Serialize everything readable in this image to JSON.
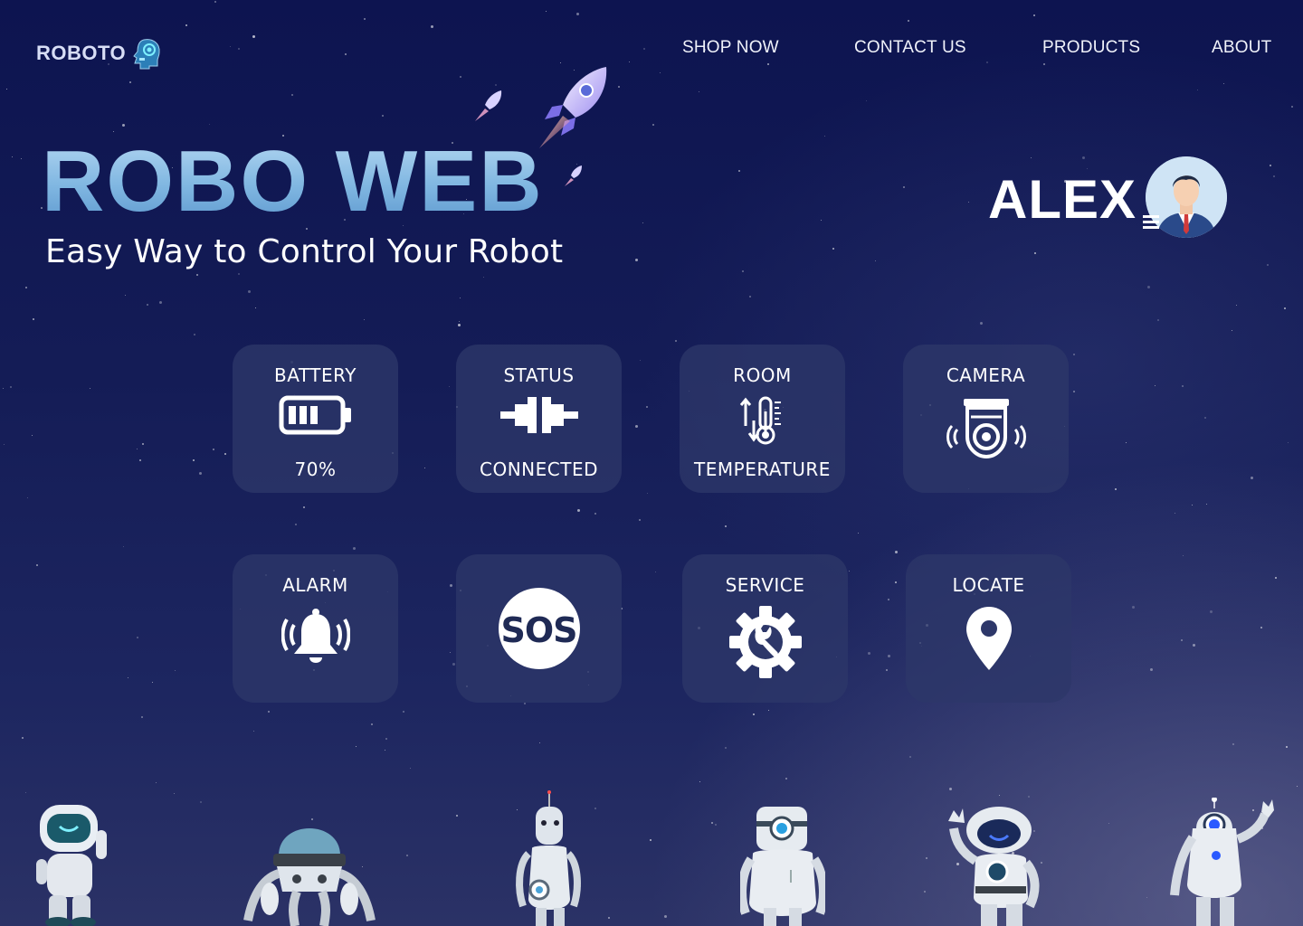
{
  "brand": {
    "name": "ROBOTO",
    "logo_icon": "robot-head-icon"
  },
  "nav": [
    {
      "label": "SHOP NOW"
    },
    {
      "label": "CONTACT US"
    },
    {
      "label": "PRODUCTS"
    },
    {
      "label": "ABOUT"
    }
  ],
  "hero": {
    "title": "ROBO WEB",
    "subtitle": "Easy Way to Control Your Robot"
  },
  "user": {
    "name": "ALEX",
    "avatar_icon": "user-avatar-icon",
    "menu_icon": "menu-icon"
  },
  "tiles": [
    {
      "label": "BATTERY",
      "value": "70%",
      "icon": "battery-icon",
      "level": 0.7
    },
    {
      "label": "STATUS",
      "value": "CONNECTED",
      "icon": "plug-icon"
    },
    {
      "label": "ROOM",
      "value": "TEMPERATURE",
      "icon": "thermometer-icon"
    },
    {
      "label": "CAMERA",
      "icon": "camera-icon"
    },
    {
      "label": "ALARM",
      "icon": "alarm-bell-icon"
    },
    {
      "label": "SOS",
      "icon": "sos-icon"
    },
    {
      "label": "SERVICE",
      "icon": "gear-wrench-icon"
    },
    {
      "label": "LOCATE",
      "icon": "location-pin-icon"
    }
  ],
  "colors": {
    "accent": "#7fb6e1",
    "tile_bg": "#2d3769",
    "background": "#141c56"
  }
}
